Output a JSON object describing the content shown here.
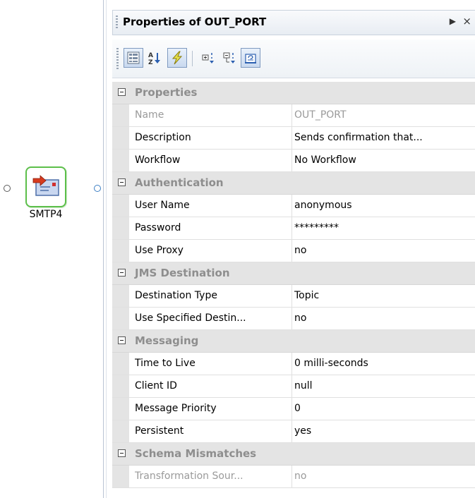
{
  "canvas": {
    "node": {
      "label": "SMTP4",
      "icon": "mail-send-icon",
      "border_color": "#5cbf4a"
    }
  },
  "panel": {
    "title": "Properties of OUT_PORT",
    "pin_glyph": "▶",
    "close_glyph": "×",
    "toolbar": [
      {
        "name": "categorized-view-icon",
        "active": true
      },
      {
        "name": "sort-alphabetical-icon",
        "active": false
      },
      {
        "name": "lightning-icon",
        "active": true
      },
      {
        "name": "expand-all-icon",
        "active": false
      },
      {
        "name": "collapse-all-icon",
        "active": false
      },
      {
        "name": "property-pages-icon",
        "active": true
      }
    ],
    "categories": {
      "properties": "Properties",
      "authentication": "Authentication",
      "jms": "JMS Destination",
      "messaging": "Messaging",
      "schema": "Schema Mismatches"
    },
    "rows": {
      "name": {
        "label": "Name",
        "value": "OUT_PORT"
      },
      "description": {
        "label": "Description",
        "value": "Sends confirmation that..."
      },
      "workflow": {
        "label": "Workflow",
        "value": "No Workflow"
      },
      "username": {
        "label": "User Name",
        "value": "anonymous"
      },
      "password": {
        "label": "Password",
        "value": "*********"
      },
      "useproxy": {
        "label": "Use Proxy",
        "value": "no"
      },
      "desttype": {
        "label": "Destination Type",
        "value": "Topic"
      },
      "usespec": {
        "label": "Use Specified Destin...",
        "value": "no"
      },
      "ttl": {
        "label": "Time to Live",
        "value": "0 milli-seconds"
      },
      "clientid": {
        "label": "Client ID",
        "value": "null"
      },
      "priority": {
        "label": "Message Priority",
        "value": "0"
      },
      "persistent": {
        "label": "Persistent",
        "value": "yes"
      },
      "transform": {
        "label": "Transformation Sour...",
        "value": "no"
      }
    }
  }
}
